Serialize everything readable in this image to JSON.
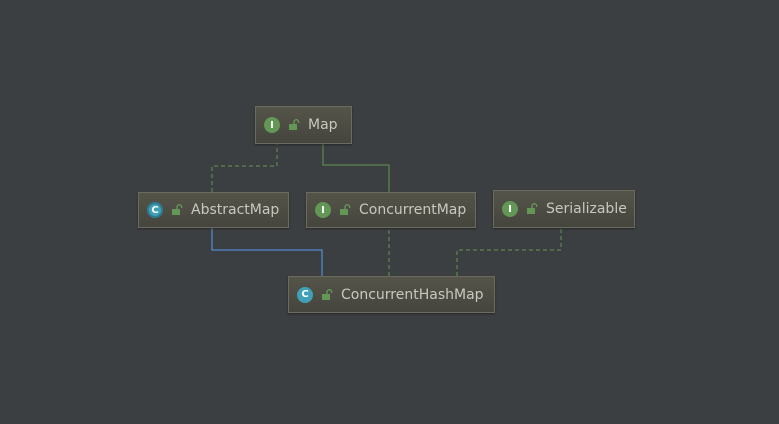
{
  "diagram": {
    "colors": {
      "background": "#3c3f41",
      "interface_arrow": "#629755",
      "class_arrow": "#589df6",
      "interface_badge": "#629755",
      "class_badge": "#40a0b8"
    },
    "nodes": {
      "map": {
        "label": "Map",
        "kind_letter": "I",
        "kind": "interface",
        "icon": "interface-icon"
      },
      "abstract_map": {
        "label": "AbstractMap",
        "kind_letter": "C",
        "kind": "abstract-class",
        "icon": "abstract-class-icon"
      },
      "concurrent_map": {
        "label": "ConcurrentMap",
        "kind_letter": "I",
        "kind": "interface",
        "icon": "interface-icon"
      },
      "serializable": {
        "label": "Serializable",
        "kind_letter": "I",
        "kind": "interface",
        "icon": "interface-icon"
      },
      "concurrent_hash_map": {
        "label": "ConcurrentHashMap",
        "kind_letter": "C",
        "kind": "class",
        "icon": "class-icon"
      }
    },
    "edges": [
      {
        "from": "abstract_map",
        "to": "map",
        "type": "implements",
        "style": "dashed"
      },
      {
        "from": "concurrent_map",
        "to": "map",
        "type": "extends",
        "style": "solid"
      },
      {
        "from": "concurrent_hash_map",
        "to": "abstract_map",
        "type": "extends",
        "style": "solid"
      },
      {
        "from": "concurrent_hash_map",
        "to": "concurrent_map",
        "type": "implements",
        "style": "dashed"
      },
      {
        "from": "concurrent_hash_map",
        "to": "serializable",
        "type": "implements",
        "style": "dashed"
      }
    ]
  }
}
